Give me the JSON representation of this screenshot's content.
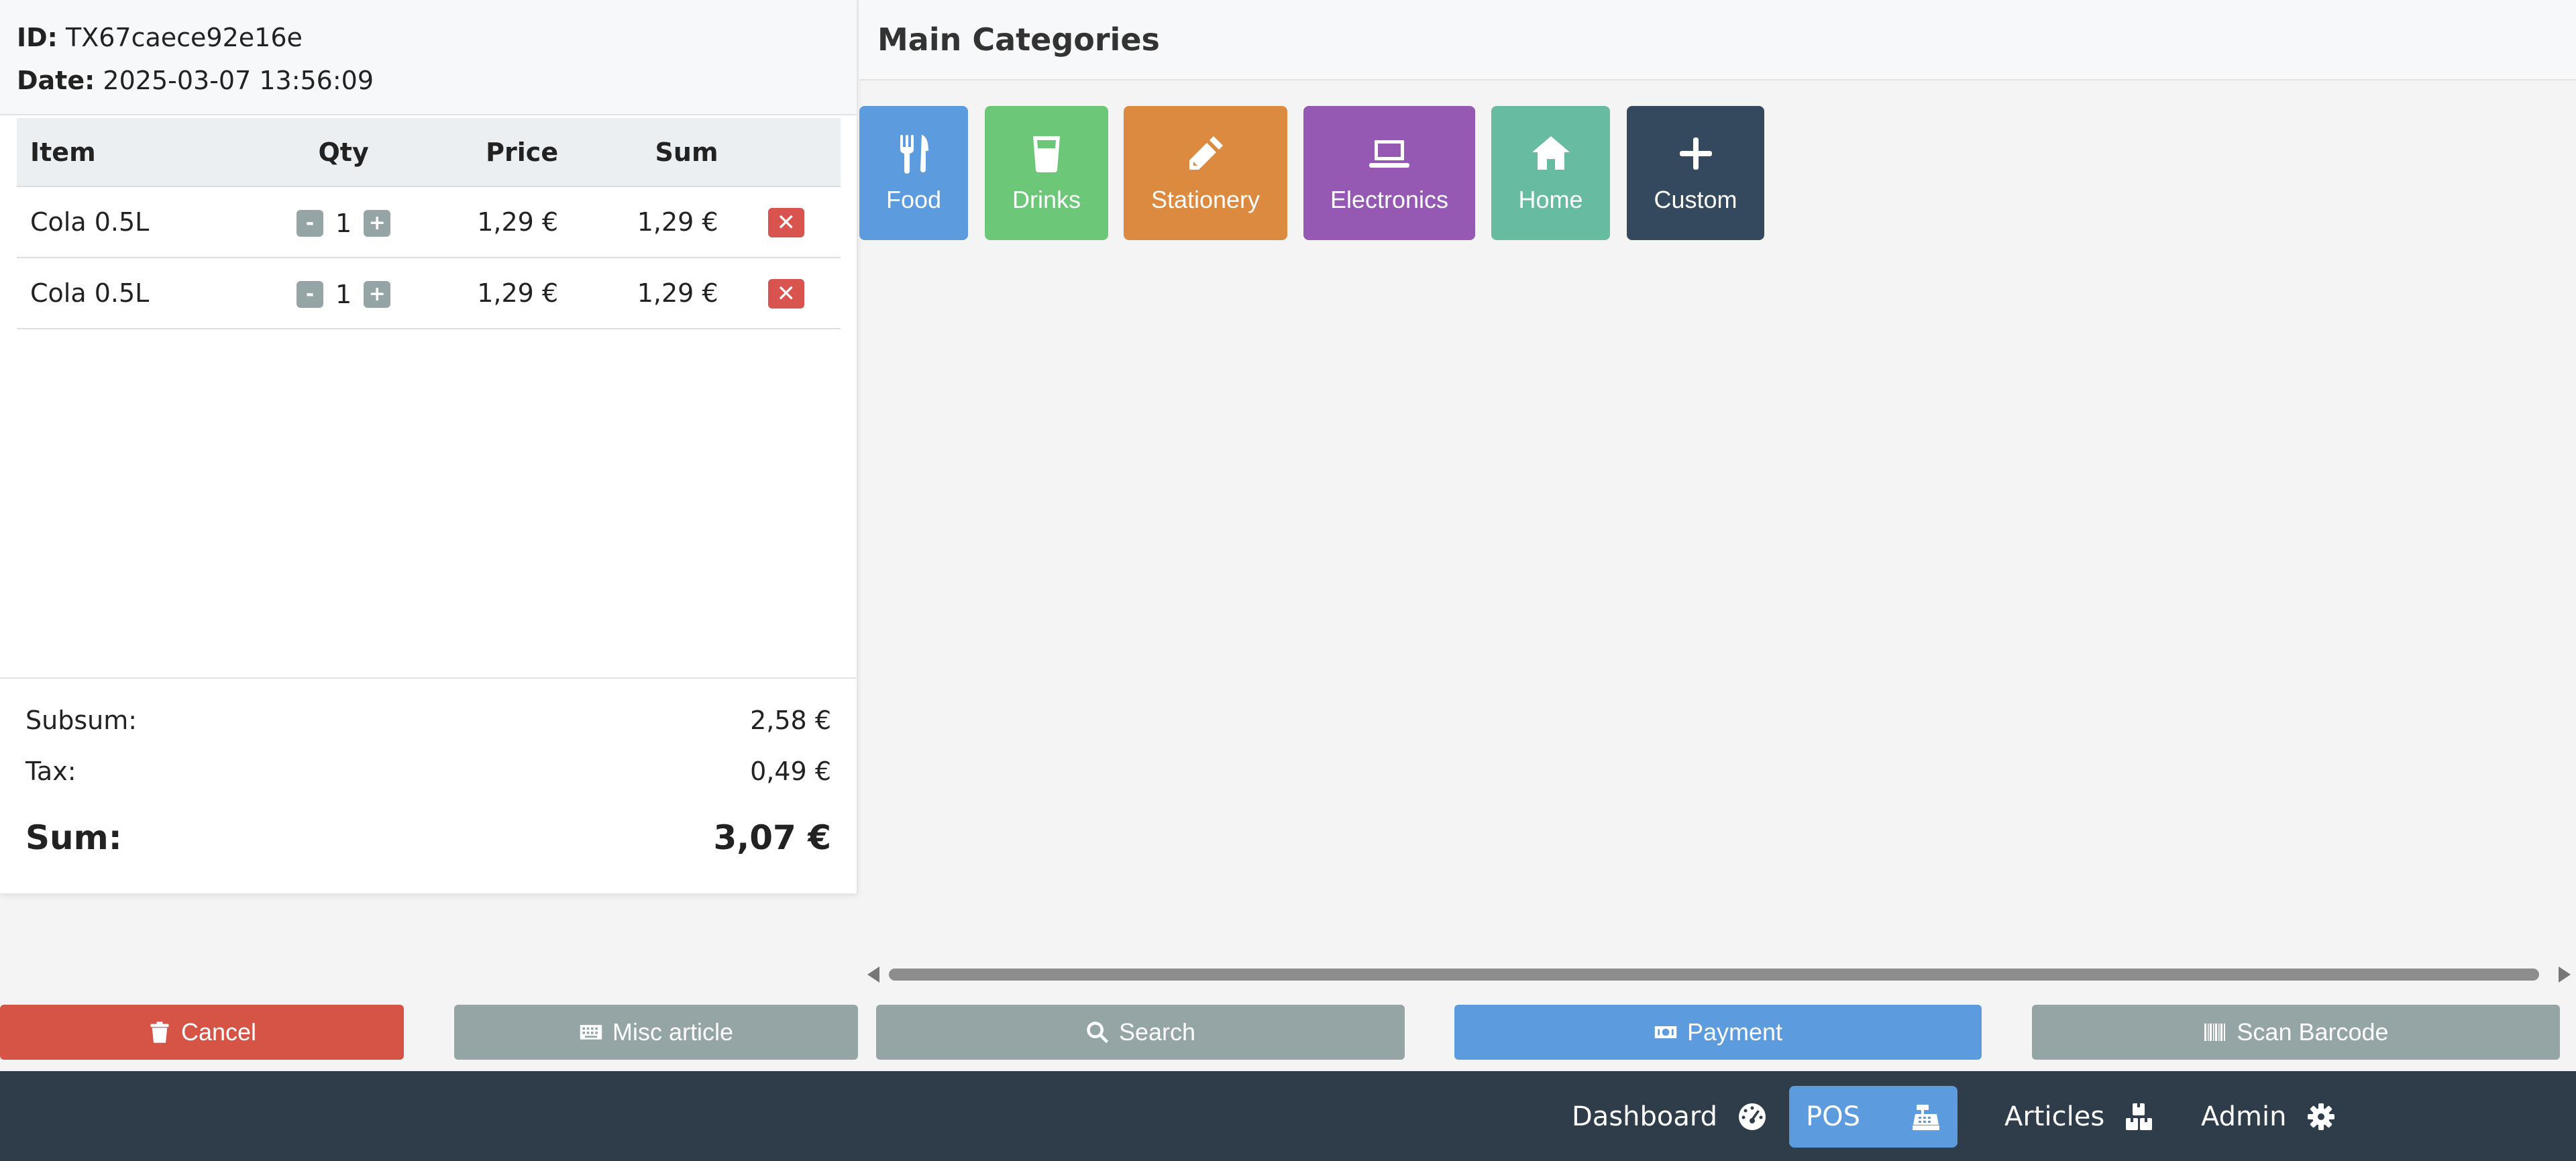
{
  "transaction": {
    "id_label": "ID:",
    "id_value": "TX67caece92e16e",
    "date_label": "Date:",
    "date_value": "2025-03-07 13:56:09"
  },
  "table": {
    "headers": {
      "item": "Item",
      "qty": "Qty",
      "price": "Price",
      "sum": "Sum"
    },
    "rows": [
      {
        "item": "Cola 0.5L",
        "qty": "1",
        "price": "1,29 €",
        "sum": "1,29 €"
      },
      {
        "item": "Cola 0.5L",
        "qty": "1",
        "price": "1,29 €",
        "sum": "1,29 €"
      }
    ],
    "minus_label": "-",
    "plus_label": "+",
    "delete_label": "✕"
  },
  "totals": {
    "subsum_label": "Subsum:",
    "subsum_value": "2,58 €",
    "tax_label": "Tax:",
    "tax_value": "0,49 €",
    "sum_label": "Sum:",
    "sum_value": "3,07 €"
  },
  "categories": {
    "title": "Main Categories",
    "items": [
      {
        "label": "Food",
        "icon": "utensils-icon",
        "color": "#5b9bde"
      },
      {
        "label": "Drinks",
        "icon": "glass-icon",
        "color": "#6cc878"
      },
      {
        "label": "Stationery",
        "icon": "pencil-icon",
        "color": "#db8a3f"
      },
      {
        "label": "Electronics",
        "icon": "laptop-icon",
        "color": "#9559b4"
      },
      {
        "label": "Home",
        "icon": "home-icon",
        "color": "#66bba0"
      },
      {
        "label": "Custom",
        "icon": "plus-icon",
        "color": "#34495e"
      }
    ]
  },
  "actions": {
    "cancel": "Cancel",
    "misc": "Misc article",
    "search": "Search",
    "payment": "Payment",
    "scan": "Scan Barcode",
    "colors": {
      "danger": "#d55446",
      "neutral": "#95a5a6",
      "primary": "#5b9bde"
    }
  },
  "nav": {
    "dashboard": "Dashboard",
    "pos": "POS",
    "articles": "Articles",
    "admin": "Admin",
    "active": "POS",
    "background": "#2f3c4a"
  }
}
